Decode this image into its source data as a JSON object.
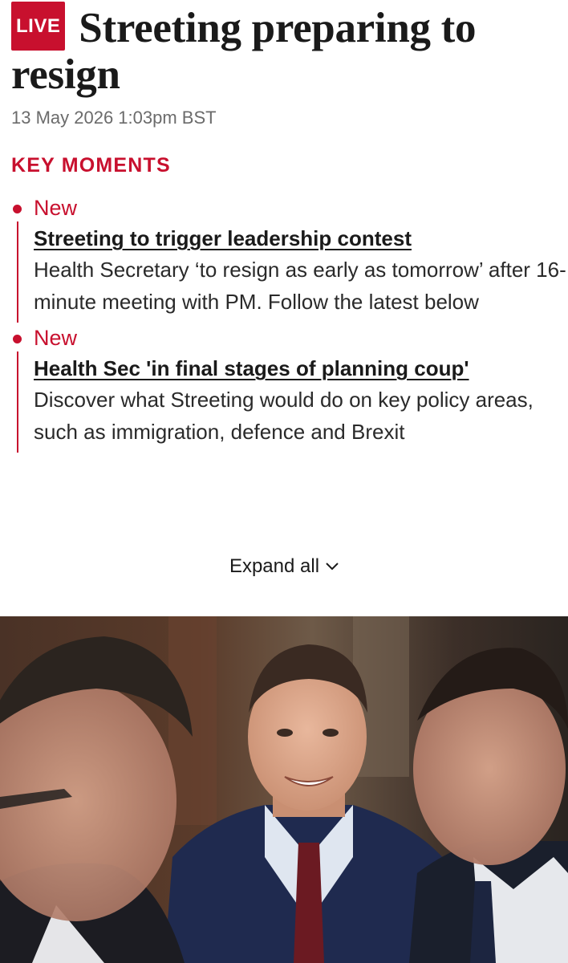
{
  "article": {
    "live_badge": "LIVE",
    "headline": "Streeting preparing to resign",
    "timestamp": "13 May 2026 1:03pm BST"
  },
  "key_moments": {
    "label": "KEY MOMENTS",
    "items": [
      {
        "tag": "New",
        "title": "Streeting to trigger leadership contest",
        "body": "Health Secretary ‘to resign as early as tomorrow’ after 16-minute meeting with PM. Follow the latest below"
      },
      {
        "tag": "New",
        "title": "Health Sec 'in final stages of planning coup'",
        "body": "Discover what Streeting would do on key policy areas, such as immigration, defence and Brexit"
      }
    ],
    "expand_label": "Expand all"
  },
  "colors": {
    "accent": "#c8102e",
    "text": "#1a1a1a",
    "muted": "#6b6b6b"
  },
  "icons": {
    "expand": "chevron-down-icon",
    "bullet": "red-dot-icon"
  }
}
